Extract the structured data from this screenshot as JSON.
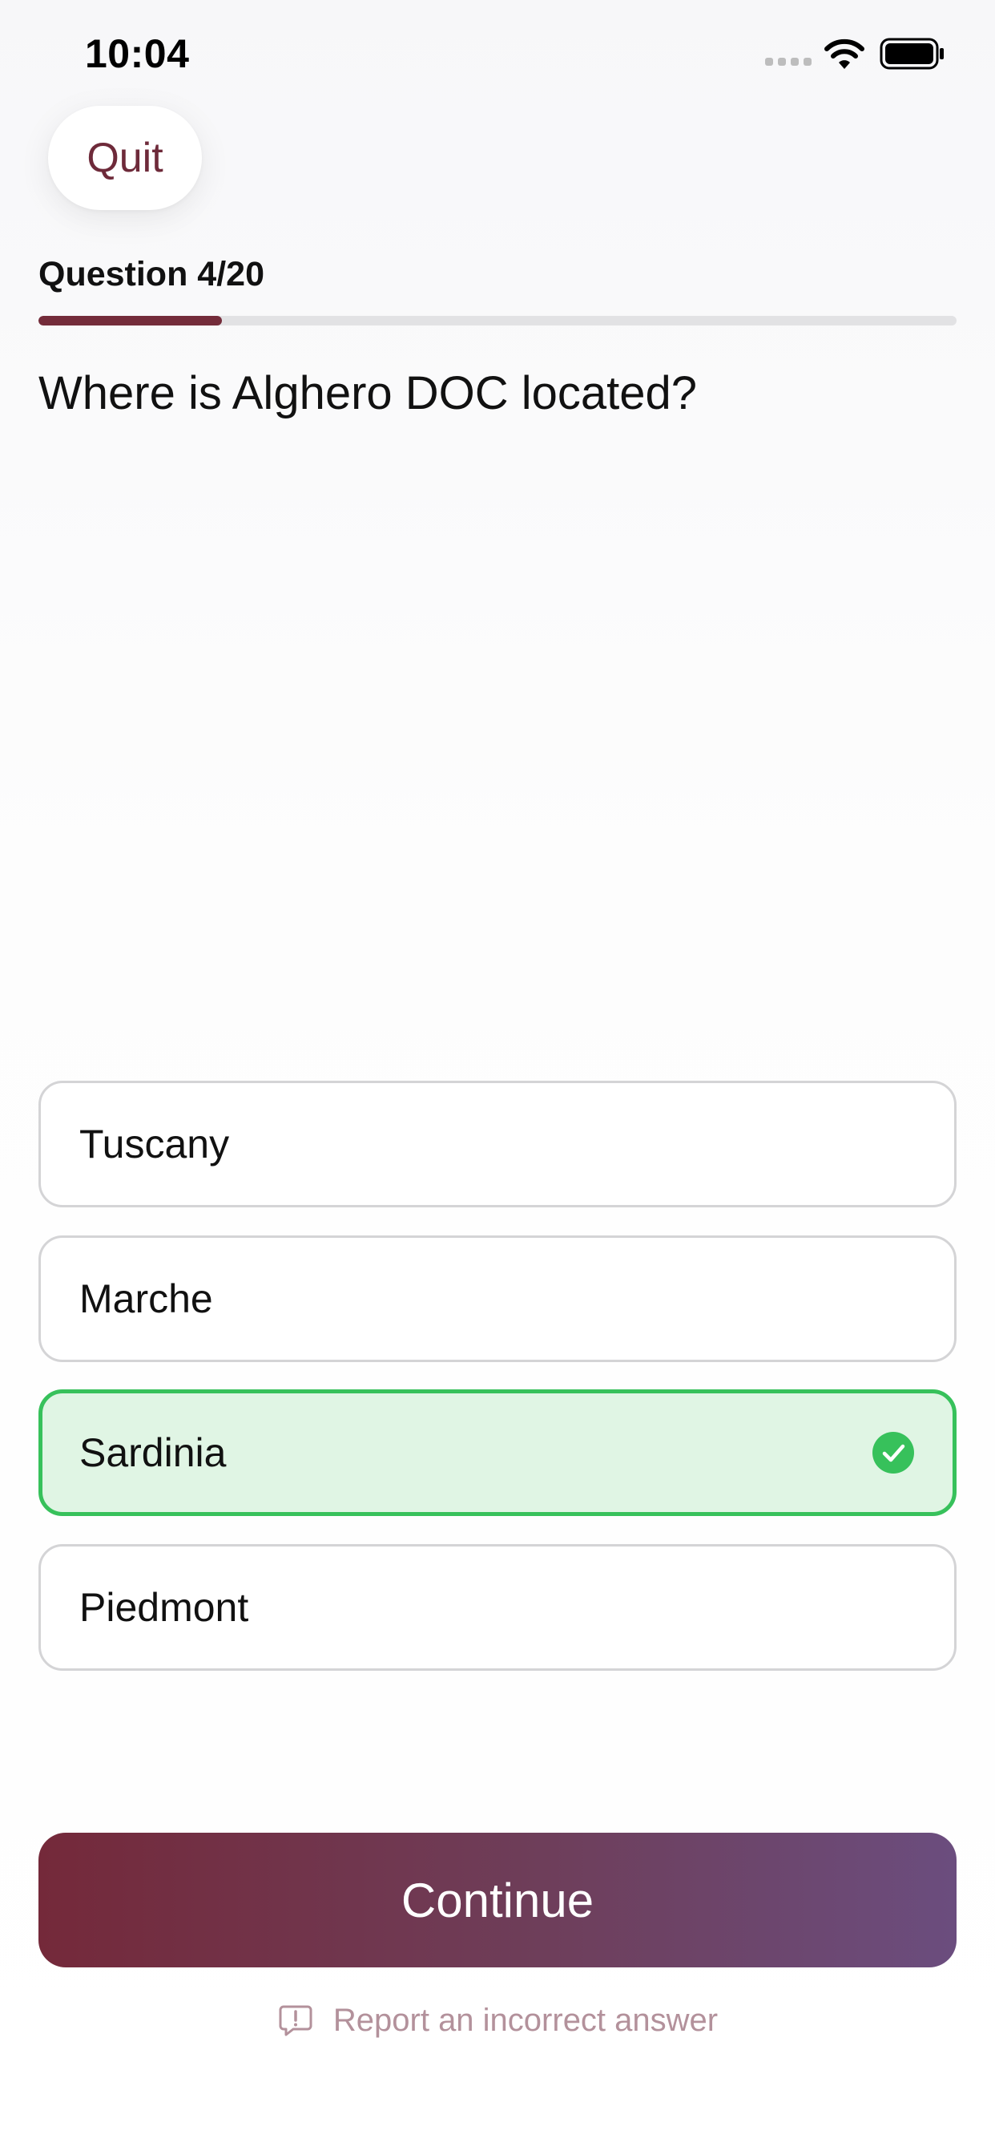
{
  "status_bar": {
    "time": "10:04",
    "icons": [
      "cellular-signal-icon",
      "wifi-icon",
      "battery-icon"
    ]
  },
  "header": {
    "quit_label": "Quit"
  },
  "progress": {
    "label": "Question 4/20",
    "fraction": 0.2
  },
  "question": {
    "text": "Where is Alghero DOC located?"
  },
  "answers": [
    {
      "label": "Tuscany",
      "state": "default"
    },
    {
      "label": "Marche",
      "state": "default"
    },
    {
      "label": "Sardinia",
      "state": "correct",
      "icon": "checkmark-circle-icon"
    },
    {
      "label": "Piedmont",
      "state": "default"
    }
  ],
  "footer": {
    "continue_label": "Continue",
    "report_label": "Report an incorrect answer",
    "report_icon": "report-bubble-icon"
  },
  "colors": {
    "accent": "#742c3a",
    "accent_end": "#6b4d7e",
    "correct": "#37c15b",
    "correct_bg": "#e0f5e4",
    "muted_link": "#b3919b"
  }
}
